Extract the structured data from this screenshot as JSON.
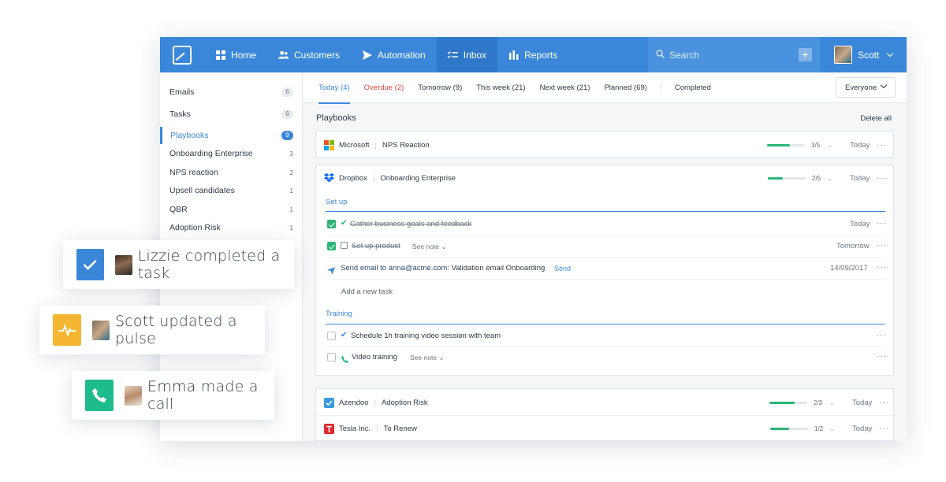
{
  "nav": {
    "items": [
      {
        "label": "Home",
        "icon": "grid-icon"
      },
      {
        "label": "Customers",
        "icon": "users-icon"
      },
      {
        "label": "Automation",
        "icon": "send-icon"
      },
      {
        "label": "Inbox",
        "icon": "checklist-icon"
      },
      {
        "label": "Reports",
        "icon": "bar-chart-icon"
      }
    ],
    "active": "Inbox",
    "search_placeholder": "Search",
    "user_name": "Scott"
  },
  "sidebar": {
    "items": [
      {
        "label": "Emails",
        "count": "6"
      },
      {
        "label": "Tasks",
        "count": "6"
      },
      {
        "label": "Playbooks",
        "count": "9"
      },
      {
        "label": "Onboarding Enterprise",
        "count": "3"
      },
      {
        "label": "NPS reaction",
        "count": "2"
      },
      {
        "label": "Upsell candidates",
        "count": "1"
      },
      {
        "label": "QBR",
        "count": "1"
      },
      {
        "label": "Adoption Risk",
        "count": "1"
      }
    ]
  },
  "tabs": {
    "items": [
      "Today (4)",
      "Overdue (2)",
      "Tomorrow (9)",
      "This week (21)",
      "Next week (21)",
      "Planned (69)",
      "Completed"
    ],
    "filter": "Everyone"
  },
  "main": {
    "title": "Playbooks",
    "delete_all": "Delete all",
    "playbooks": [
      {
        "company": "Microsoft",
        "name": "NPS Reaction",
        "progress": 0.6,
        "fraction": "3/5",
        "when": "Today"
      },
      {
        "company": "Dropbox",
        "name": "Onboarding Enterprise",
        "progress": 0.4,
        "fraction": "2/5",
        "when": "Today"
      },
      {
        "company": "Azendoo",
        "name": "Adoption Risk",
        "progress": 0.67,
        "fraction": "2/3",
        "when": "Today"
      },
      {
        "company": "Tesla Inc.",
        "name": "To Renew",
        "progress": 0.5,
        "fraction": "1/2",
        "when": "Today"
      }
    ],
    "sections": {
      "setup": "Set up",
      "training": "Training"
    },
    "tasks": {
      "t1": {
        "text": "Gather business goals and feedback",
        "when": "Today"
      },
      "t2": {
        "text": "Set up product",
        "note": "See note",
        "when": "Tomorrow"
      },
      "t3": {
        "text_bold": "Send email to anna@acme.com:",
        "text": "Validation email Onboarding",
        "action": "Send",
        "when": "14/09/2017"
      },
      "add": "Add a new task",
      "t4": {
        "text": "Schedule 1h training video session with team"
      },
      "t5": {
        "text": "Video training",
        "note": "See note"
      }
    }
  },
  "notifications": [
    {
      "name": "Lizzie",
      "action": "completed a task",
      "color": "#3a87da",
      "icon": "check-icon"
    },
    {
      "name": "Scott",
      "action": "updated a pulse",
      "color": "#f5b731",
      "icon": "pulse-icon"
    },
    {
      "name": "Emma",
      "action": "made a call",
      "color": "#1ebc8c",
      "icon": "phone-icon"
    }
  ]
}
